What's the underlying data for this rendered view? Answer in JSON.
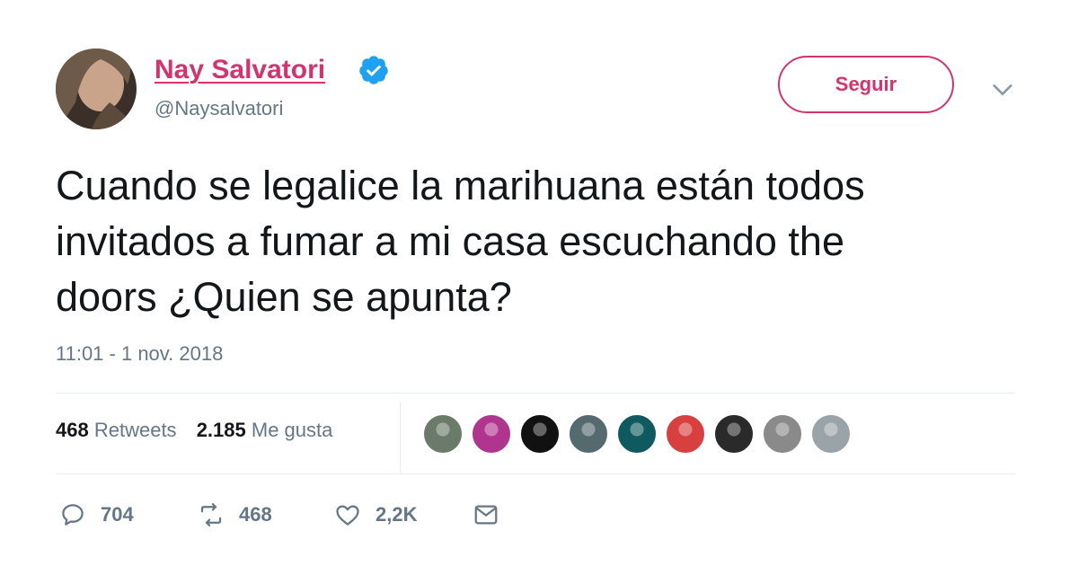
{
  "user": {
    "display_name": "Nay Salvatori",
    "handle": "@Naysalvatori",
    "verified_icon": "verified-badge-icon"
  },
  "follow_label": "Seguir",
  "tweet": {
    "lines": [
      "Cuando se legalice la marihuana están todos",
      "invitados a fumar a mi casa escuchando the",
      "doors ¿Quien se apunta?"
    ],
    "timestamp": "11:01 - 1 nov. 2018"
  },
  "stats": {
    "retweets_count": "468",
    "retweets_label": "Retweets",
    "likes_count": "2.185",
    "likes_label": "Me gusta"
  },
  "liker_avatar_colors": [
    "#6b7b6a",
    "#b0358f",
    "#111111",
    "#556a6e",
    "#0f5a60",
    "#d8403f",
    "#2a2a2a",
    "#8a8a8a",
    "#9aa3a8"
  ],
  "actions": {
    "replies": "704",
    "retweets": "468",
    "likes": "2,2K"
  },
  "colors": {
    "accent": "#d6336c",
    "verified": "#1da1f2",
    "muted": "#657786"
  }
}
